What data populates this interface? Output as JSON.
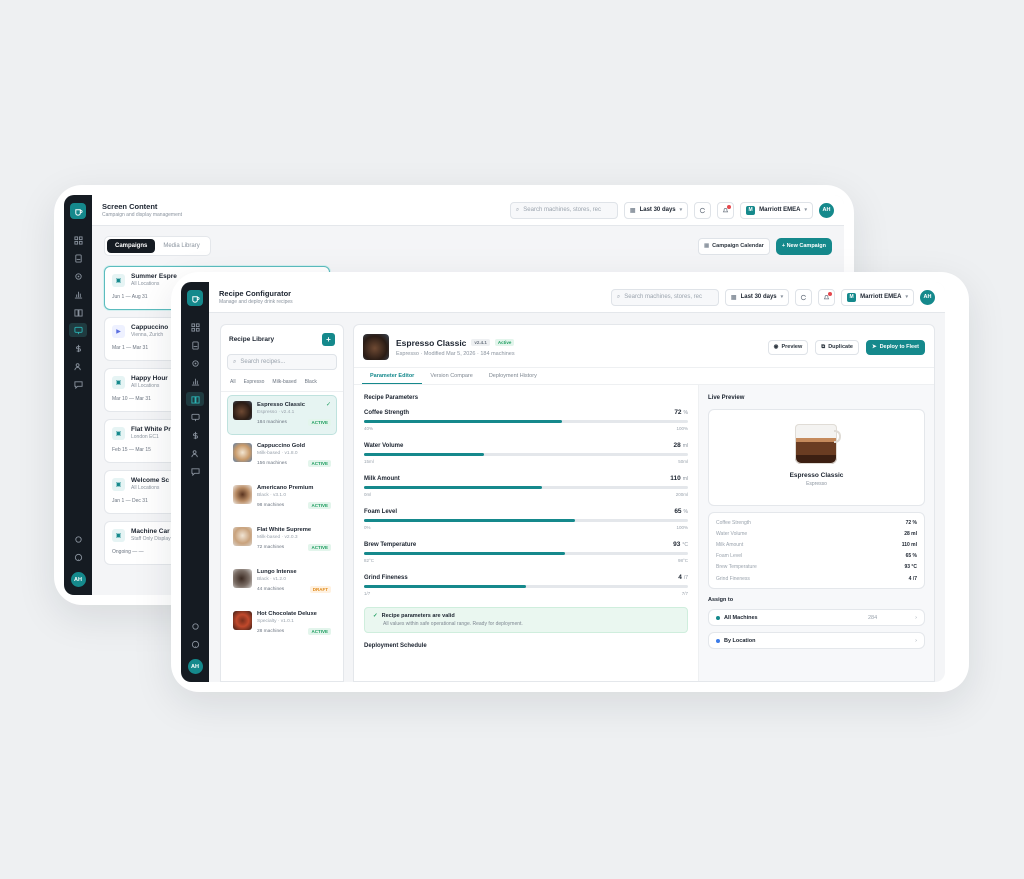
{
  "back": {
    "title": "Screen Content",
    "subtitle": "Campaign and display management",
    "search_placeholder": "Search machines, stores, rec",
    "date_range": "Last 30 days",
    "org": "Marriott EMEA",
    "org_mark": "M",
    "avatar": "AH",
    "tabs": [
      "Campaigns",
      "Media Library"
    ],
    "calendar_label": "Campaign Calendar",
    "new_label": "+ New Campaign",
    "campaigns": [
      {
        "name": "Summer Espre",
        "place": "All Locations",
        "dates": "Jun 1 — Aug 31"
      },
      {
        "name": "Cappuccino",
        "place": "Vienna, Zurich",
        "dates": "Mar 1 — Mar 31"
      },
      {
        "name": "Happy Hour",
        "place": "All Locations",
        "dates": "Mar 10 — Mar 31"
      },
      {
        "name": "Flat White Pr",
        "place": "London EC1",
        "dates": "Feb 15 — Mar 15"
      },
      {
        "name": "Welcome Sc",
        "place": "All Locations",
        "dates": "Jan 1 — Dec 31"
      },
      {
        "name": "Machine Car",
        "place": "Staff Only Display",
        "dates": "Ongoing — —"
      }
    ]
  },
  "front": {
    "title": "Recipe Configurator",
    "subtitle": "Manage and deploy drink recipes",
    "search_placeholder": "Search machines, stores, rec",
    "date_range": "Last 30 days",
    "org": "Marriott EMEA",
    "org_mark": "M",
    "avatar": "AH",
    "library": {
      "title": "Recipe Library",
      "add": "+",
      "search_placeholder": "Search recipes...",
      "filters": [
        "All",
        "Espresso",
        "Milk-based",
        "Black"
      ],
      "items": [
        {
          "name": "Espresso Classic",
          "meta": "Espresso · v2.4.1",
          "machines": "184 machines",
          "status": "ACTIVE",
          "cls": "a"
        },
        {
          "name": "Cappuccino Gold",
          "meta": "Milk-based · v1.8.0",
          "machines": "156 machines",
          "status": "ACTIVE",
          "cls": "a"
        },
        {
          "name": "Americano Premium",
          "meta": "Black · v3.1.0",
          "machines": "98 machines",
          "status": "ACTIVE",
          "cls": "a"
        },
        {
          "name": "Flat White Supreme",
          "meta": "Milk-based · v2.0.3",
          "machines": "72 machines",
          "status": "ACTIVE",
          "cls": "a"
        },
        {
          "name": "Lungo Intense",
          "meta": "Black · v1.2.0",
          "machines": "44 machines",
          "status": "DRAFT",
          "cls": "d"
        },
        {
          "name": "Hot Chocolate Deluxe",
          "meta": "Specialty · v1.0.1",
          "machines": "28 machines",
          "status": "ACTIVE",
          "cls": "a"
        }
      ]
    },
    "recipe": {
      "name": "Espresso Classic",
      "version": "v2.4.1",
      "status": "Active",
      "meta": "Espresso · Modified Mar 5, 2026 · 184 machines",
      "preview": "Preview",
      "duplicate": "Duplicate",
      "deploy": "Deploy to Fleet"
    },
    "tabs": [
      "Parameter Editor",
      "Version Compare",
      "Deployment History"
    ],
    "params_title": "Recipe Parameters",
    "params": [
      {
        "name": "Coffee Strength",
        "value": "72",
        "unit": "%",
        "min": "40%",
        "max": "100%",
        "fill": 0.61
      },
      {
        "name": "Water Volume",
        "value": "28",
        "unit": "ml",
        "min": "15ml",
        "max": "50ml",
        "fill": 0.37
      },
      {
        "name": "Milk Amount",
        "value": "110",
        "unit": "ml",
        "min": "0ml",
        "max": "200ml",
        "fill": 0.55
      },
      {
        "name": "Foam Level",
        "value": "65",
        "unit": "%",
        "min": "0%",
        "max": "100%",
        "fill": 0.65
      },
      {
        "name": "Brew Temperature",
        "value": "93",
        "unit": "°C",
        "min": "82°C",
        "max": "98°C",
        "fill": 0.62
      },
      {
        "name": "Grind Fineness",
        "value": "4",
        "unit": "/7",
        "min": "1/7",
        "max": "7/7",
        "fill": 0.5
      }
    ],
    "valid_title": "Recipe parameters are valid",
    "valid_sub": "All values within safe operational range. Ready for deployment.",
    "next_section": "Deployment Schedule",
    "live": {
      "title": "Live Preview",
      "drink": "Espresso Classic",
      "category": "Espresso",
      "stats": [
        {
          "k": "Coffee Strength",
          "v": "72 %"
        },
        {
          "k": "Water Volume",
          "v": "28 ml"
        },
        {
          "k": "Milk Amount",
          "v": "110 ml"
        },
        {
          "k": "Foam Level",
          "v": "65 %"
        },
        {
          "k": "Brew Temperature",
          "v": "93 °C"
        },
        {
          "k": "Grind Fineness",
          "v": "4 /7"
        }
      ],
      "assign_title": "Assign to",
      "assign": [
        {
          "label": "All Machines",
          "count": "284",
          "color": "#15898c"
        },
        {
          "label": "By Location",
          "count": "",
          "color": "#3b7be8"
        }
      ]
    }
  }
}
